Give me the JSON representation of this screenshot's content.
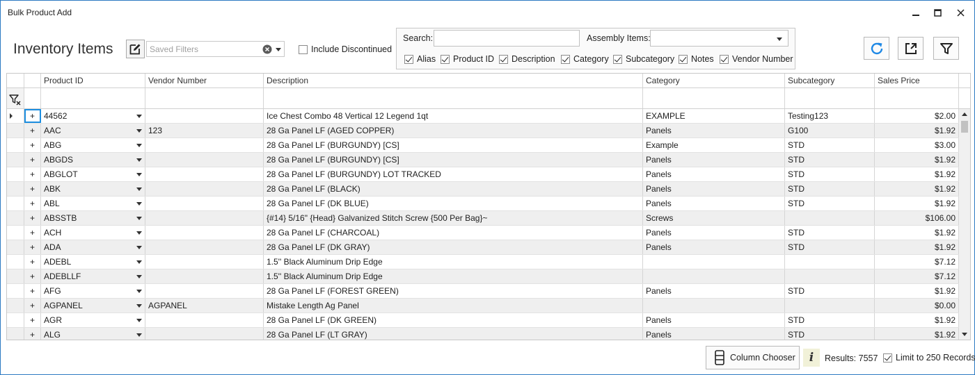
{
  "window": {
    "title": "Bulk Product Add"
  },
  "page_title": "Inventory Items",
  "saved_filters": {
    "placeholder": "Saved Filters"
  },
  "include_discontinued": {
    "label": "Include Discontinued",
    "checked": false
  },
  "search": {
    "label": "Search:",
    "value": "",
    "assembly_label": "Assembly Items:",
    "assembly_value": "",
    "fields": [
      {
        "label": "Alias",
        "checked": true
      },
      {
        "label": "Product ID",
        "checked": true
      },
      {
        "label": "Description",
        "checked": true
      },
      {
        "label": "Category",
        "checked": true
      },
      {
        "label": "Subcategory",
        "checked": true
      },
      {
        "label": "Notes",
        "checked": true
      },
      {
        "label": "Vendor Number",
        "checked": true
      }
    ]
  },
  "toolbar": {
    "icons": [
      "refresh-icon",
      "export-icon",
      "filter-icon"
    ]
  },
  "grid": {
    "columns": [
      "Product ID",
      "Vendor Number",
      "Description",
      "Category",
      "Subcategory",
      "Sales Price"
    ],
    "expander": "+",
    "rows": [
      {
        "pid": "44562",
        "vendor": "",
        "desc": "Ice Chest Combo 48 Vertical 12 Legend 1qt",
        "cat": "EXAMPLE",
        "subcat": "Testing123",
        "price": "$2.00"
      },
      {
        "pid": "AAC",
        "vendor": "123",
        "desc": "28 Ga Panel LF (AGED COPPER)",
        "cat": "Panels",
        "subcat": "G100",
        "price": "$1.92"
      },
      {
        "pid": "ABG",
        "vendor": "",
        "desc": "28 Ga Panel LF (BURGUNDY) [CS]",
        "cat": "Example",
        "subcat": "STD",
        "price": "$3.00"
      },
      {
        "pid": "ABGDS",
        "vendor": "",
        "desc": "28 Ga Panel LF (BURGUNDY) [CS]",
        "cat": "Panels",
        "subcat": "STD",
        "price": "$1.92"
      },
      {
        "pid": "ABGLOT",
        "vendor": "",
        "desc": "28 Ga Panel LF (BURGUNDY) LOT TRACKED",
        "cat": "Panels",
        "subcat": "STD",
        "price": "$1.92"
      },
      {
        "pid": "ABK",
        "vendor": "",
        "desc": "28 Ga Panel LF (BLACK)",
        "cat": "Panels",
        "subcat": "STD",
        "price": "$1.92"
      },
      {
        "pid": "ABL",
        "vendor": "",
        "desc": "28 Ga Panel LF (DK BLUE)",
        "cat": "Panels",
        "subcat": "STD",
        "price": "$1.92"
      },
      {
        "pid": "ABSSTB",
        "vendor": "",
        "desc": "{#14} 5/16\" {Head} Galvanized Stitch Screw {500 Per Bag}~",
        "cat": "Screws",
        "subcat": "",
        "price": "$106.00"
      },
      {
        "pid": "ACH",
        "vendor": "",
        "desc": "28 Ga Panel LF (CHARCOAL)",
        "cat": "Panels",
        "subcat": "STD",
        "price": "$1.92"
      },
      {
        "pid": "ADA",
        "vendor": "",
        "desc": "28 Ga Panel LF (DK GRAY)",
        "cat": "Panels",
        "subcat": "STD",
        "price": "$1.92"
      },
      {
        "pid": "ADEBL",
        "vendor": "",
        "desc": "1.5'' Black  Aluminum Drip Edge",
        "cat": "",
        "subcat": "",
        "price": "$7.12"
      },
      {
        "pid": "ADEBLLF",
        "vendor": "",
        "desc": "1.5'' Black  Aluminum Drip Edge",
        "cat": "",
        "subcat": "",
        "price": "$7.12"
      },
      {
        "pid": "AFG",
        "vendor": "",
        "desc": "28 Ga Panel LF (FOREST GREEN)",
        "cat": "Panels",
        "subcat": "STD",
        "price": "$1.92"
      },
      {
        "pid": "AGPANEL",
        "vendor": "AGPANEL",
        "desc": "Mistake Length Ag Panel",
        "cat": "",
        "subcat": "",
        "price": "$0.00"
      },
      {
        "pid": "AGR",
        "vendor": "",
        "desc": "28 Ga Panel LF (DK GREEN)",
        "cat": "Panels",
        "subcat": "STD",
        "price": "$1.92"
      },
      {
        "pid": "ALG",
        "vendor": "",
        "desc": "28 Ga Panel LF (LT GRAY)",
        "cat": "Panels",
        "subcat": "STD",
        "price": "$1.92"
      }
    ]
  },
  "footer": {
    "column_chooser": "Column Chooser",
    "results": "Results: 7557",
    "limit_label": "Limit to 250 Records",
    "limit_checked": true
  },
  "colors": {
    "accent": "#1c8ee0",
    "refresh": "#1e88e5",
    "alt_row": "#efefef",
    "border": "#2b79c2"
  }
}
